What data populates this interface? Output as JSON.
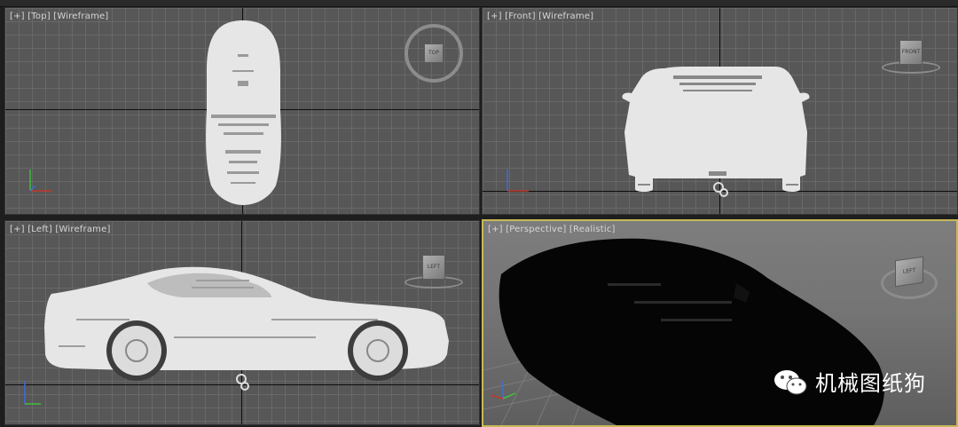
{
  "viewports": {
    "top": {
      "label_plus": "[+]",
      "label_view": "[Top]",
      "label_mode": "[Wireframe]"
    },
    "front": {
      "label_plus": "[+]",
      "label_view": "[Front]",
      "label_mode": "[Wireframe]"
    },
    "left": {
      "label_plus": "[+]",
      "label_view": "[Left]",
      "label_mode": "[Wireframe]"
    },
    "perspective": {
      "label_plus": "[+]",
      "label_view": "[Perspective]",
      "label_mode": "[Realistic]"
    }
  },
  "viewcubes": {
    "top": "TOP",
    "front": "FRONT",
    "left": "LEFT",
    "perspective": "LEFT"
  },
  "watermark": {
    "text": "机械图纸狗",
    "icon": "wechat-icon"
  },
  "colors": {
    "active_border": "#c8b85a",
    "model": "#e8e8e8",
    "grid": "#575757",
    "axis_x": "#c0392b",
    "axis_y": "#3fbf3f",
    "axis_z": "#3a6fd8"
  }
}
